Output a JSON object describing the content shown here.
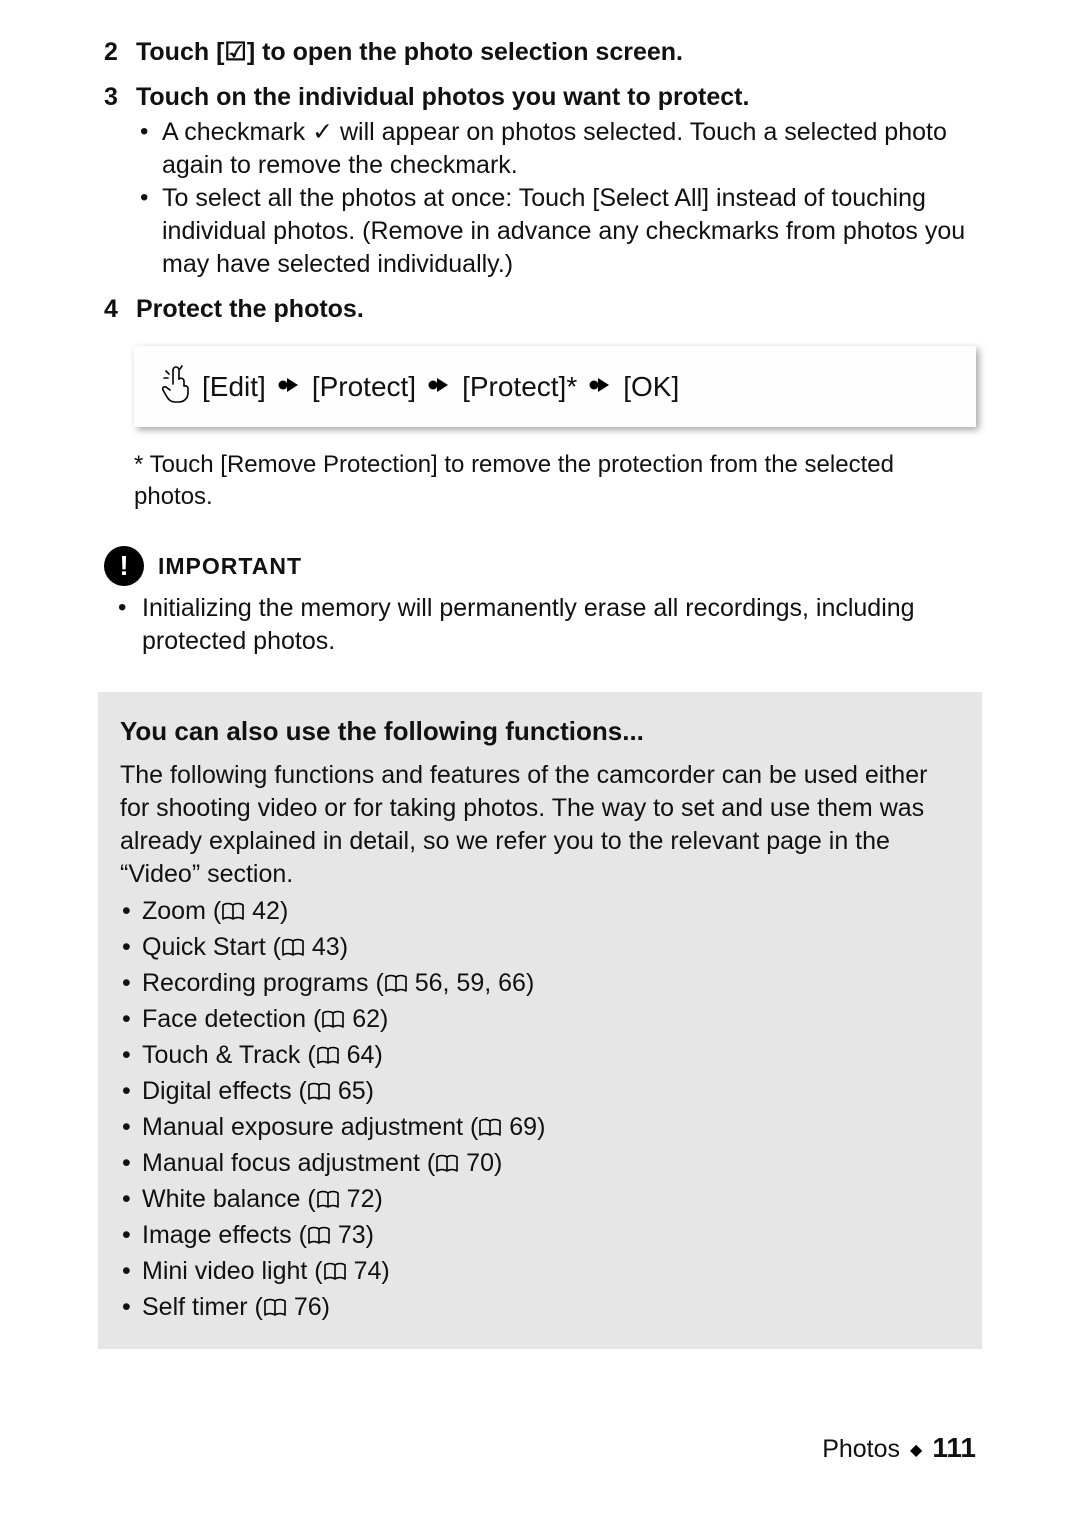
{
  "steps": {
    "s2": {
      "num": "2",
      "head_a": "Touch [",
      "head_b": "] to open the photo selection screen."
    },
    "s3": {
      "num": "3",
      "head": "Touch on the individual photos you want to protect.",
      "b1a": "A checkmark ",
      "b1b": " will appear on photos selected. Touch a selected photo again to remove the checkmark.",
      "b2": "To select all the photos at once: Touch [Select All] instead of touching individual photos. (Remove in advance any checkmarks from photos you may have selected individually.)"
    },
    "s4": {
      "num": "4",
      "head": "Protect the photos."
    }
  },
  "path": {
    "p1": "[Edit]",
    "p2": "[Protect]",
    "p3": "[Protect]*",
    "p4": "[OK]"
  },
  "footnote": "* Touch [Remove Protection] to remove the protection from the selected photos.",
  "important": {
    "label": "IMPORTANT",
    "item": "Initializing the memory will permanently erase all recordings, including protected photos."
  },
  "panel": {
    "title": "You can also use the following functions...",
    "body": "The following functions and features of the camcorder can be used either for shooting video or for taking photos. The way to set and use them was already explained in detail, so we refer you to the relevant page in the “Video” section.",
    "items": [
      {
        "name": "Zoom",
        "pages": "42"
      },
      {
        "name": "Quick Start",
        "pages": "43"
      },
      {
        "name": "Recording programs",
        "pages": "56, 59, 66"
      },
      {
        "name": "Face detection",
        "pages": "62"
      },
      {
        "name": "Touch & Track",
        "pages": "64"
      },
      {
        "name": "Digital effects",
        "pages": "65"
      },
      {
        "name": "Manual exposure adjustment",
        "pages": "69"
      },
      {
        "name": "Manual focus adjustment",
        "pages": "70"
      },
      {
        "name": "White balance",
        "pages": "72"
      },
      {
        "name": "Image effects",
        "pages": "73"
      },
      {
        "name": "Mini video light",
        "pages": "74"
      },
      {
        "name": "Self timer",
        "pages": "76"
      }
    ]
  },
  "footer": {
    "section": "Photos",
    "page": "111"
  },
  "glyphs": {
    "check": "✓",
    "select_icon": "☑"
  }
}
